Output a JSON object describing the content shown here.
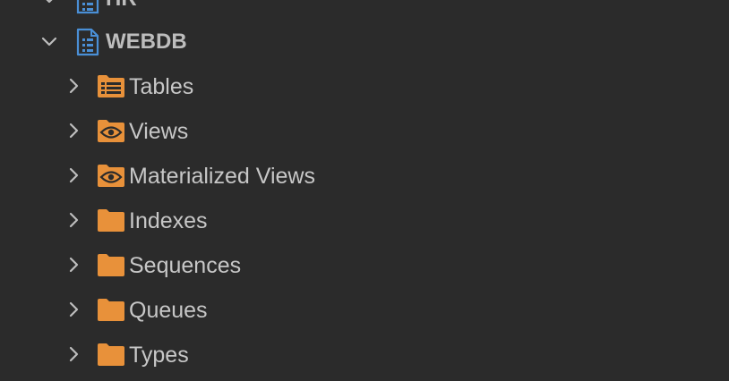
{
  "tree": {
    "partial_top": {
      "label": "HR"
    },
    "schema": {
      "label": "WEBDB",
      "expanded": true,
      "icon": "database-schema-icon"
    },
    "children": [
      {
        "label": "Tables",
        "icon": "tables-folder-icon"
      },
      {
        "label": "Views",
        "icon": "views-folder-icon"
      },
      {
        "label": "Materialized Views",
        "icon": "materialized-views-folder-icon"
      },
      {
        "label": "Indexes",
        "icon": "folder-icon"
      },
      {
        "label": "Sequences",
        "icon": "folder-icon"
      },
      {
        "label": "Queues",
        "icon": "folder-icon"
      },
      {
        "label": "Types",
        "icon": "folder-icon"
      }
    ]
  },
  "colors": {
    "background": "#2b2b2b",
    "folder": "#e8913a",
    "schema_icon": "#4a8fd6",
    "chevron": "#bdbdbd",
    "text": "#c7c7c7"
  }
}
